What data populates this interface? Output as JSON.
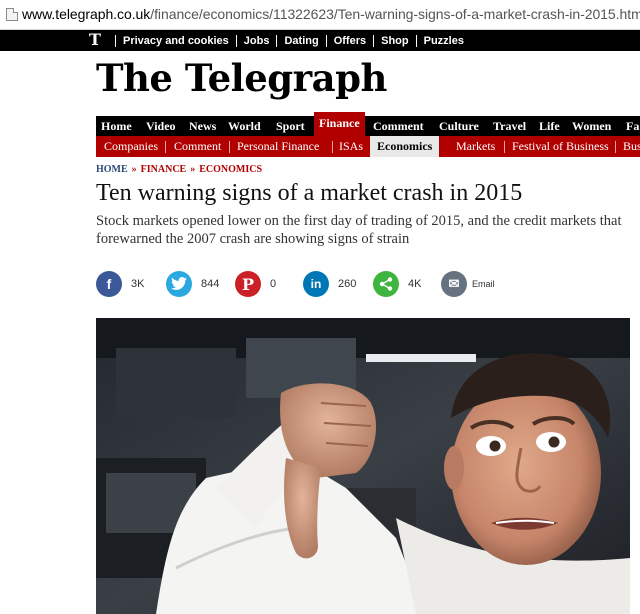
{
  "browser": {
    "url_domain": "www.telegraph.co.uk",
    "url_path": "/finance/economics/11322623/Ten-warning-signs-of-a-market-crash-in-2015.html"
  },
  "topbar": {
    "logo_letter": "T",
    "links": [
      "Privacy and cookies",
      "Jobs",
      "Dating",
      "Offers",
      "Shop",
      "Puzzles"
    ]
  },
  "masthead": {
    "title": "The Telegraph"
  },
  "main_nav": {
    "items": [
      "Home",
      "Video",
      "News",
      "World",
      "Sport",
      "Finance",
      "Comment",
      "Culture",
      "Travel",
      "Life",
      "Women",
      "Fa"
    ],
    "active": "Finance"
  },
  "sub_nav": {
    "items": [
      "Companies",
      "Comment",
      "Personal Finance",
      "ISAs",
      "Economics",
      "Markets",
      "Festival of Business",
      "Bus"
    ],
    "active": "Economics"
  },
  "breadcrumb": {
    "home": "HOME",
    "section": "FINANCE",
    "subsection": "ECONOMICS",
    "separator": "»"
  },
  "article": {
    "headline": "Ten warning signs of a market crash in 2015",
    "standfirst": "Stock markets opened lower on the first day of trading of 2015, and the credit markets that forewarned the 2007 crash are showing signs of strain"
  },
  "share": {
    "facebook": {
      "icon": "facebook-icon",
      "glyph": "f",
      "count": "3K",
      "color": "#3b5998"
    },
    "twitter": {
      "icon": "twitter-icon",
      "glyph": "t",
      "count": "844",
      "color": "#2aa9e0"
    },
    "pinterest": {
      "icon": "pinterest-icon",
      "glyph": "P",
      "count": "0",
      "color": "#cb2027"
    },
    "linkedin": {
      "icon": "linkedin-icon",
      "glyph": "in",
      "count": "260",
      "color": "#0077b5"
    },
    "sharethis": {
      "icon": "share-icon",
      "glyph": "<",
      "count": "4K",
      "color": "#3fb53f"
    },
    "email": {
      "icon": "email-icon",
      "glyph": "✉",
      "count": "Email",
      "color": "#66727f"
    }
  },
  "colors": {
    "brand_red": "#b00000",
    "nav_black": "#000000"
  }
}
